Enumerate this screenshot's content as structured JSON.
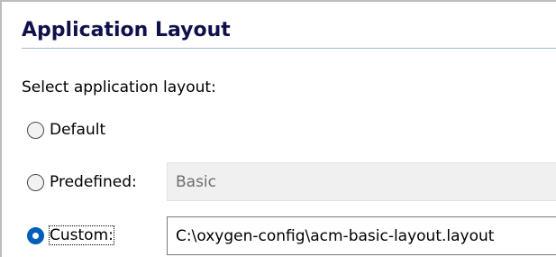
{
  "section": {
    "title": "Application Layout"
  },
  "prompt": "Select application layout:",
  "options": {
    "default": {
      "label": "Default",
      "checked": false
    },
    "predefined": {
      "label": "Predefined:",
      "checked": false,
      "value": "Basic"
    },
    "custom": {
      "label": "Custom:",
      "checked": true,
      "value": "C:\\oxygen-config\\acm-basic-layout.layout"
    }
  },
  "colors": {
    "title": "#10104a",
    "accent": "#005fb8",
    "rule": "#9eb6d6"
  }
}
